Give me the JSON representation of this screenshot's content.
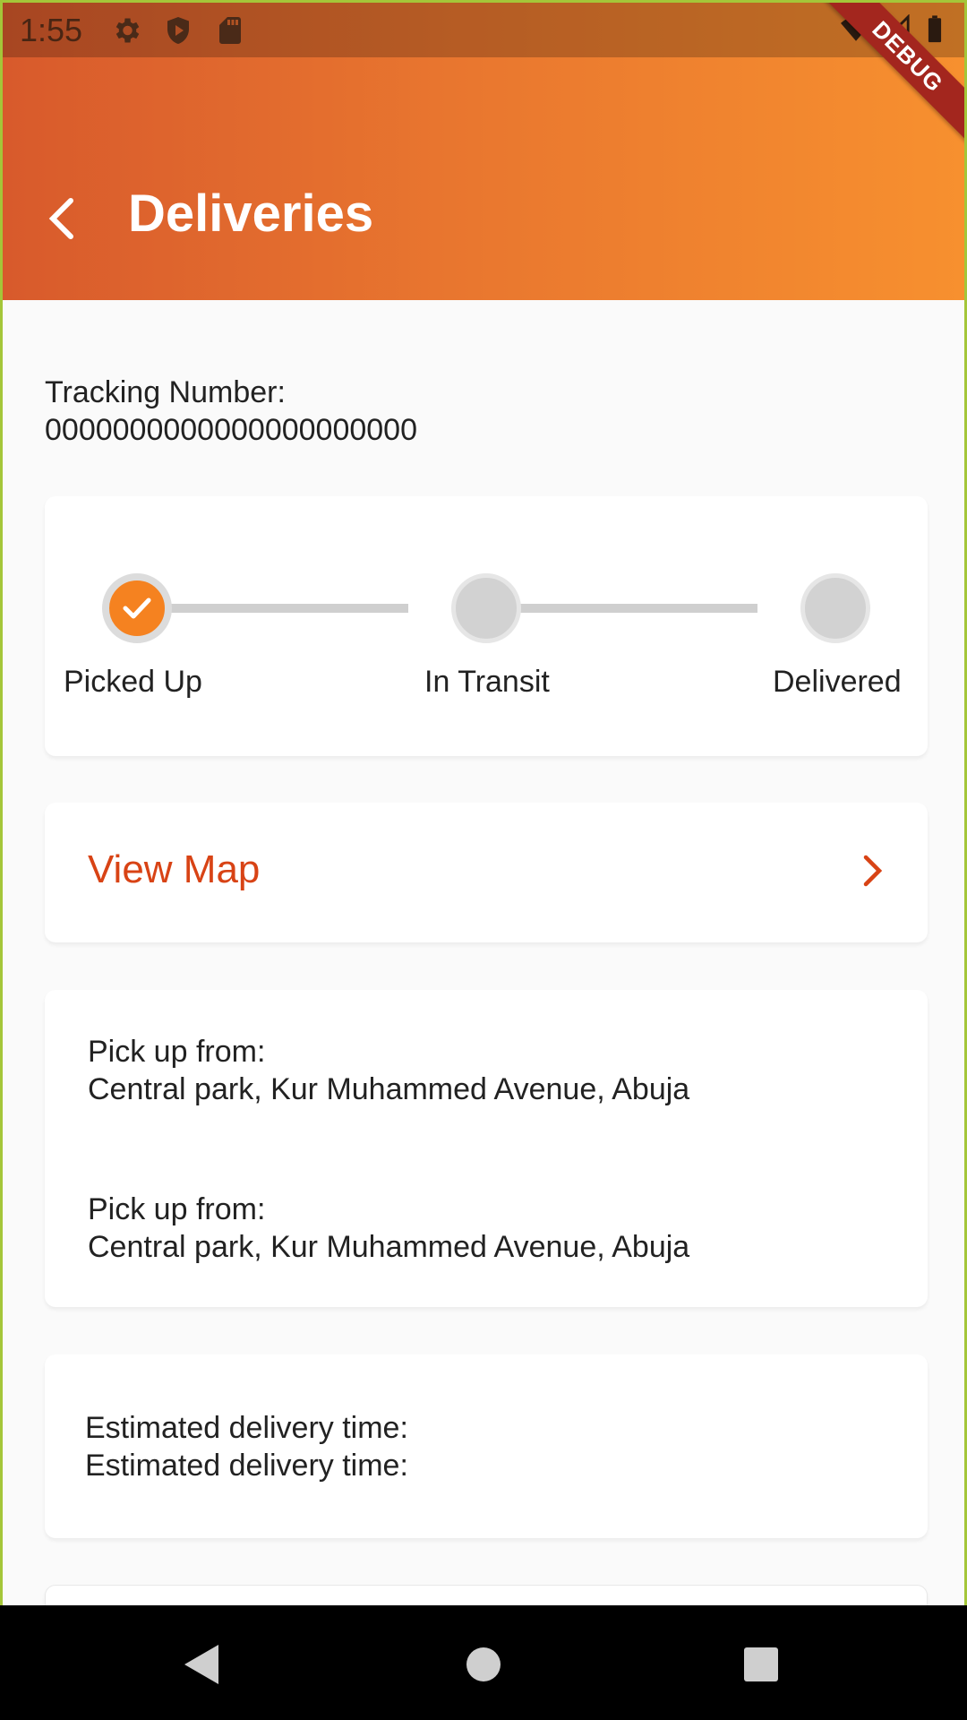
{
  "status_bar": {
    "time": "1:55",
    "icons_left": [
      "gear-icon",
      "shield-icon",
      "sd-card-icon"
    ],
    "icons_right": [
      "wifi-icon",
      "signal-icon",
      "battery-icon"
    ],
    "debug_label": "DEBUG"
  },
  "header": {
    "title": "Deliveries",
    "back_icon": "chevron-left-icon",
    "gradient_colors": [
      "#d85a2c",
      "#f7902f"
    ]
  },
  "tracking": {
    "label": "Tracking Number:",
    "number": "0000000000000000000000"
  },
  "stepper": {
    "steps": [
      {
        "label": "Picked Up",
        "completed": true
      },
      {
        "label": "In Transit",
        "completed": false
      },
      {
        "label": "Delivered",
        "completed": false
      }
    ],
    "active_color": "#f58220",
    "inactive_color": "#d2d2d2"
  },
  "view_map": {
    "label": "View Map",
    "color": "#d84315"
  },
  "addresses": [
    {
      "label": "Pick up from:",
      "value": "Central park, Kur Muhammed Avenue, Abuja"
    },
    {
      "label": "Pick up from:",
      "value": "Central park, Kur Muhammed Avenue, Abuja"
    }
  ],
  "eta": {
    "line1": "Estimated delivery time:",
    "line2": "Estimated delivery time:"
  },
  "nav_bar": {
    "buttons": [
      "back-triangle-icon",
      "home-circle-icon",
      "recents-square-icon"
    ]
  }
}
